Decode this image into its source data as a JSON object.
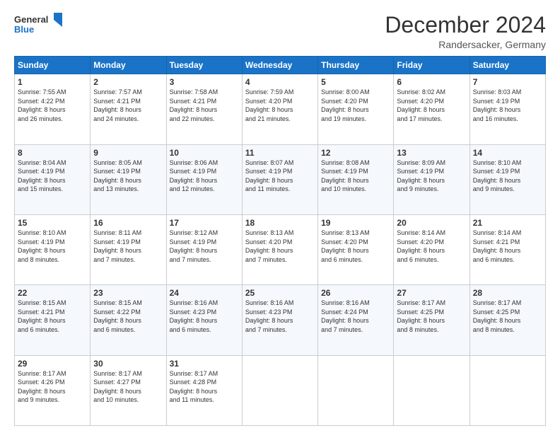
{
  "header": {
    "logo_line1": "General",
    "logo_line2": "Blue",
    "title": "December 2024",
    "subtitle": "Randersacker, Germany"
  },
  "days_of_week": [
    "Sunday",
    "Monday",
    "Tuesday",
    "Wednesday",
    "Thursday",
    "Friday",
    "Saturday"
  ],
  "weeks": [
    [
      {
        "day": "1",
        "info": "Sunrise: 7:55 AM\nSunset: 4:22 PM\nDaylight: 8 hours\nand 26 minutes."
      },
      {
        "day": "2",
        "info": "Sunrise: 7:57 AM\nSunset: 4:21 PM\nDaylight: 8 hours\nand 24 minutes."
      },
      {
        "day": "3",
        "info": "Sunrise: 7:58 AM\nSunset: 4:21 PM\nDaylight: 8 hours\nand 22 minutes."
      },
      {
        "day": "4",
        "info": "Sunrise: 7:59 AM\nSunset: 4:20 PM\nDaylight: 8 hours\nand 21 minutes."
      },
      {
        "day": "5",
        "info": "Sunrise: 8:00 AM\nSunset: 4:20 PM\nDaylight: 8 hours\nand 19 minutes."
      },
      {
        "day": "6",
        "info": "Sunrise: 8:02 AM\nSunset: 4:20 PM\nDaylight: 8 hours\nand 17 minutes."
      },
      {
        "day": "7",
        "info": "Sunrise: 8:03 AM\nSunset: 4:19 PM\nDaylight: 8 hours\nand 16 minutes."
      }
    ],
    [
      {
        "day": "8",
        "info": "Sunrise: 8:04 AM\nSunset: 4:19 PM\nDaylight: 8 hours\nand 15 minutes."
      },
      {
        "day": "9",
        "info": "Sunrise: 8:05 AM\nSunset: 4:19 PM\nDaylight: 8 hours\nand 13 minutes."
      },
      {
        "day": "10",
        "info": "Sunrise: 8:06 AM\nSunset: 4:19 PM\nDaylight: 8 hours\nand 12 minutes."
      },
      {
        "day": "11",
        "info": "Sunrise: 8:07 AM\nSunset: 4:19 PM\nDaylight: 8 hours\nand 11 minutes."
      },
      {
        "day": "12",
        "info": "Sunrise: 8:08 AM\nSunset: 4:19 PM\nDaylight: 8 hours\nand 10 minutes."
      },
      {
        "day": "13",
        "info": "Sunrise: 8:09 AM\nSunset: 4:19 PM\nDaylight: 8 hours\nand 9 minutes."
      },
      {
        "day": "14",
        "info": "Sunrise: 8:10 AM\nSunset: 4:19 PM\nDaylight: 8 hours\nand 9 minutes."
      }
    ],
    [
      {
        "day": "15",
        "info": "Sunrise: 8:10 AM\nSunset: 4:19 PM\nDaylight: 8 hours\nand 8 minutes."
      },
      {
        "day": "16",
        "info": "Sunrise: 8:11 AM\nSunset: 4:19 PM\nDaylight: 8 hours\nand 7 minutes."
      },
      {
        "day": "17",
        "info": "Sunrise: 8:12 AM\nSunset: 4:19 PM\nDaylight: 8 hours\nand 7 minutes."
      },
      {
        "day": "18",
        "info": "Sunrise: 8:13 AM\nSunset: 4:20 PM\nDaylight: 8 hours\nand 7 minutes."
      },
      {
        "day": "19",
        "info": "Sunrise: 8:13 AM\nSunset: 4:20 PM\nDaylight: 8 hours\nand 6 minutes."
      },
      {
        "day": "20",
        "info": "Sunrise: 8:14 AM\nSunset: 4:20 PM\nDaylight: 8 hours\nand 6 minutes."
      },
      {
        "day": "21",
        "info": "Sunrise: 8:14 AM\nSunset: 4:21 PM\nDaylight: 8 hours\nand 6 minutes."
      }
    ],
    [
      {
        "day": "22",
        "info": "Sunrise: 8:15 AM\nSunset: 4:21 PM\nDaylight: 8 hours\nand 6 minutes."
      },
      {
        "day": "23",
        "info": "Sunrise: 8:15 AM\nSunset: 4:22 PM\nDaylight: 8 hours\nand 6 minutes."
      },
      {
        "day": "24",
        "info": "Sunrise: 8:16 AM\nSunset: 4:23 PM\nDaylight: 8 hours\nand 6 minutes."
      },
      {
        "day": "25",
        "info": "Sunrise: 8:16 AM\nSunset: 4:23 PM\nDaylight: 8 hours\nand 7 minutes."
      },
      {
        "day": "26",
        "info": "Sunrise: 8:16 AM\nSunset: 4:24 PM\nDaylight: 8 hours\nand 7 minutes."
      },
      {
        "day": "27",
        "info": "Sunrise: 8:17 AM\nSunset: 4:25 PM\nDaylight: 8 hours\nand 8 minutes."
      },
      {
        "day": "28",
        "info": "Sunrise: 8:17 AM\nSunset: 4:25 PM\nDaylight: 8 hours\nand 8 minutes."
      }
    ],
    [
      {
        "day": "29",
        "info": "Sunrise: 8:17 AM\nSunset: 4:26 PM\nDaylight: 8 hours\nand 9 minutes."
      },
      {
        "day": "30",
        "info": "Sunrise: 8:17 AM\nSunset: 4:27 PM\nDaylight: 8 hours\nand 10 minutes."
      },
      {
        "day": "31",
        "info": "Sunrise: 8:17 AM\nSunset: 4:28 PM\nDaylight: 8 hours\nand 11 minutes."
      },
      null,
      null,
      null,
      null
    ]
  ]
}
